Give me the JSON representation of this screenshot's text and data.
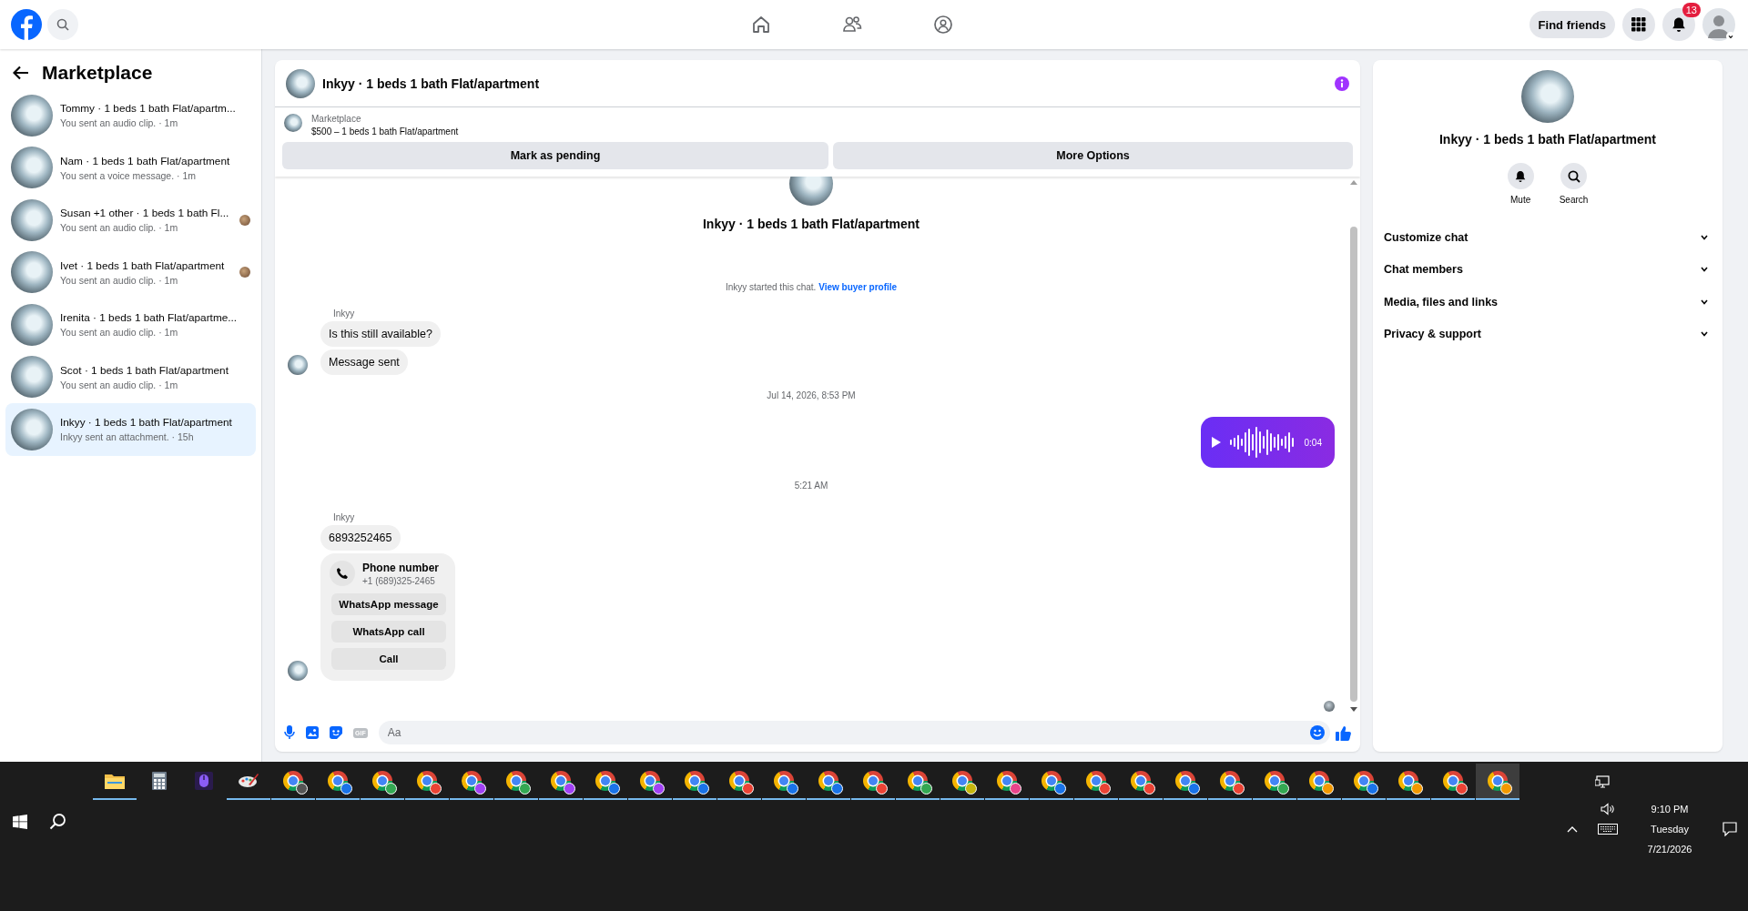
{
  "top_bar": {
    "find_friends": "Find friends",
    "notification_count": "13"
  },
  "sidebar": {
    "title": "Marketplace",
    "conversations": [
      {
        "title": "Tommy · 1 beds 1 bath Flat/apartm...",
        "subtitle": "You sent an audio clip. · 1m",
        "seen": false,
        "selected": false
      },
      {
        "title": "Nam · 1 beds 1 bath Flat/apartment",
        "subtitle": "You sent a voice message. · 1m",
        "seen": false,
        "selected": false
      },
      {
        "title": "Susan +1 other · 1 beds 1 bath Fl...",
        "subtitle": "You sent an audio clip. · 1m",
        "seen": true,
        "selected": false
      },
      {
        "title": "Ivet · 1 beds 1 bath Flat/apartment",
        "subtitle": "You sent an audio clip. · 1m",
        "seen": true,
        "selected": false
      },
      {
        "title": "Irenita · 1 beds 1 bath Flat/apartme...",
        "subtitle": "You sent an audio clip. · 1m",
        "seen": false,
        "selected": false
      },
      {
        "title": "Scot · 1 beds 1 bath Flat/apartment",
        "subtitle": "You sent an audio clip. · 1m",
        "seen": false,
        "selected": false
      },
      {
        "title": "Inkyy · 1 beds 1 bath Flat/apartment",
        "subtitle": "Inkyy sent an attachment. · 15h",
        "seen": false,
        "selected": true
      }
    ]
  },
  "chat": {
    "title": "Inkyy · 1 beds 1 bath Flat/apartment",
    "listing": {
      "source": "Marketplace",
      "price_title": "$500 – 1 beds 1 bath Flat/apartment"
    },
    "actions": [
      "Mark as pending",
      "More Options"
    ],
    "intro_name": "Inkyy · 1 beds 1 bath Flat/apartment",
    "messages": [
      {
        "kind": "system",
        "text": "Inkyy started this chat.",
        "link": "View buyer profile"
      },
      {
        "kind": "sender",
        "text": "Inkyy"
      },
      {
        "kind": "incoming",
        "text": "Is this still available?",
        "avatar": false
      },
      {
        "kind": "incoming",
        "text": "Message sent",
        "avatar": true
      },
      {
        "kind": "timestamp",
        "text": "Jul 14, 2026, 8:53 PM"
      },
      {
        "kind": "audio",
        "duration": "0:04"
      },
      {
        "kind": "timestamp",
        "text": "5:21 AM"
      },
      {
        "kind": "sender",
        "text": "Inkyy"
      },
      {
        "kind": "incoming",
        "text": "6893252465",
        "avatar": false
      },
      {
        "kind": "contact",
        "title": "Phone number",
        "number": "+1 (689)325-2465",
        "buttons": [
          "WhatsApp message",
          "WhatsApp call",
          "Call"
        ],
        "avatar": true
      }
    ],
    "seen": true,
    "composer": {
      "placeholder": "Aa",
      "gif_label": "GIF"
    }
  },
  "details": {
    "title": "Inkyy · 1 beds 1 bath Flat/apartment",
    "actions": [
      {
        "kind": "mute",
        "label": "Mute"
      },
      {
        "kind": "search",
        "label": "Search"
      }
    ],
    "sections": [
      {
        "label": "Customize chat",
        "expanded": false
      },
      {
        "label": "Chat members",
        "expanded": false
      },
      {
        "label": "Media, files and links",
        "expanded": false
      },
      {
        "label": "Privacy & support",
        "expanded": false
      }
    ]
  },
  "taskbar": {
    "apps": [
      {
        "kind": "explorer",
        "running": true,
        "selected": false
      },
      {
        "kind": "calculator",
        "running": false,
        "selected": false
      },
      {
        "kind": "app",
        "running": false,
        "selected": false
      },
      {
        "kind": "paint",
        "running": true,
        "selected": false
      },
      {
        "kind": "browser",
        "color": "#555555",
        "running": true,
        "selected": false
      },
      {
        "kind": "browser",
        "color": "#1a73e8",
        "running": true,
        "selected": false
      },
      {
        "kind": "browser",
        "color": "#34a853",
        "running": true,
        "selected": false
      },
      {
        "kind": "browser",
        "color": "#ea4335",
        "running": true,
        "selected": false
      },
      {
        "kind": "browser",
        "color": "#a142f4",
        "running": true,
        "selected": false
      },
      {
        "kind": "browser",
        "color": "#34a853",
        "running": true,
        "selected": false
      },
      {
        "kind": "browser",
        "color": "#a142f4",
        "running": true,
        "selected": false
      },
      {
        "kind": "browser",
        "color": "#1a73e8",
        "running": true,
        "selected": false
      },
      {
        "kind": "browser",
        "color": "#a142f4",
        "running": true,
        "selected": false
      },
      {
        "kind": "browser",
        "color": "#1a73e8",
        "running": true,
        "selected": false
      },
      {
        "kind": "browser",
        "color": "#ea4335",
        "running": true,
        "selected": false
      },
      {
        "kind": "browser",
        "color": "#1a73e8",
        "running": true,
        "selected": false
      },
      {
        "kind": "browser",
        "color": "#1a73e8",
        "running": true,
        "selected": false
      },
      {
        "kind": "browser",
        "color": "#ea4335",
        "running": true,
        "selected": false
      },
      {
        "kind": "browser",
        "color": "#34a853",
        "running": true,
        "selected": false
      },
      {
        "kind": "browser",
        "color": "#c5b60e",
        "running": true,
        "selected": false
      },
      {
        "kind": "browser",
        "color": "#e8458b",
        "running": true,
        "selected": false
      },
      {
        "kind": "browser",
        "color": "#1a73e8",
        "running": true,
        "selected": false
      },
      {
        "kind": "browser",
        "color": "#ea4335",
        "running": true,
        "selected": false
      },
      {
        "kind": "browser",
        "color": "#ea4335",
        "running": true,
        "selected": false
      },
      {
        "kind": "browser",
        "color": "#1a73e8",
        "running": true,
        "selected": false
      },
      {
        "kind": "browser",
        "color": "#ea4335",
        "running": true,
        "selected": false
      },
      {
        "kind": "browser",
        "color": "#34a853",
        "running": true,
        "selected": false
      },
      {
        "kind": "browser",
        "color": "#f29900",
        "running": true,
        "selected": false
      },
      {
        "kind": "browser",
        "color": "#1a73e8",
        "running": true,
        "selected": false
      },
      {
        "kind": "browser",
        "color": "#f29900",
        "running": true,
        "selected": false
      },
      {
        "kind": "browser",
        "color": "#ea4335",
        "running": true,
        "selected": false
      },
      {
        "kind": "browser",
        "color": "#f29900",
        "running": true,
        "selected": true
      }
    ],
    "clock": {
      "time": "9:10 PM",
      "day": "Tuesday",
      "date": "7/21/2026"
    }
  }
}
